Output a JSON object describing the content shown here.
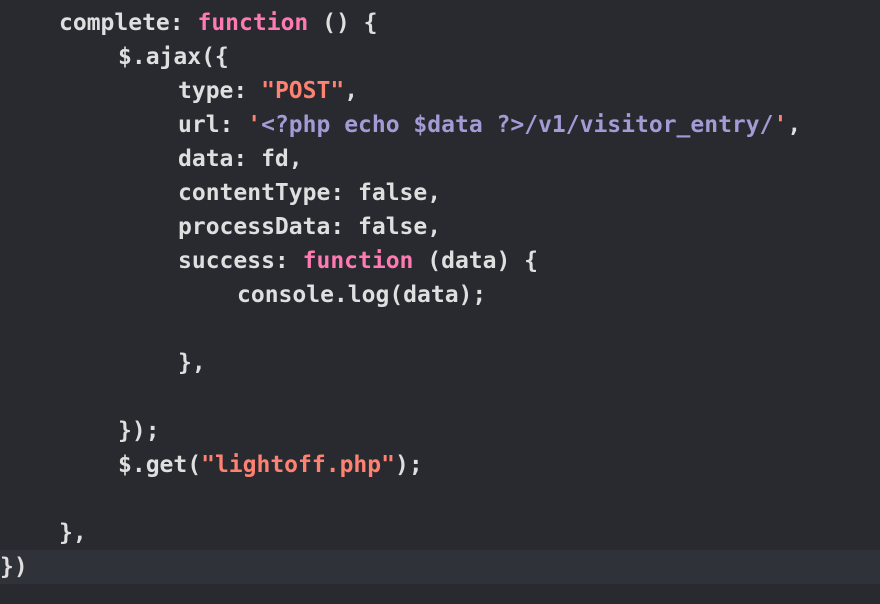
{
  "editor": {
    "colors": {
      "background": "#292a30",
      "text": "#dfdfe0",
      "keyword": "#ff7ab2",
      "string": "#ff8170",
      "embedded_php": "#a29bd6",
      "current_line": "#2f3239"
    },
    "code": {
      "l1": {
        "a": "complete: ",
        "kw": "function",
        "b": " () {"
      },
      "l2": {
        "a": "$.ajax({"
      },
      "l3": {
        "a": "type: ",
        "str": "\"POST\"",
        "b": ","
      },
      "l4": {
        "a": "url: ",
        "q1": "'",
        "php": "<?php echo $data ?>",
        "s": "/v1/visitor_entry/",
        "q2": "'",
        "b": ","
      },
      "l5": {
        "a": "data: fd,"
      },
      "l6": {
        "a": "contentType: false,"
      },
      "l7": {
        "a": "processData: false,"
      },
      "l8": {
        "a": "success: ",
        "kw": "function",
        "b": " (data) {"
      },
      "l9": {
        "a": "console.log(data);"
      },
      "l11": {
        "a": "},"
      },
      "l13": {
        "a": "});"
      },
      "l14": {
        "a": "$.get(",
        "str": "\"lightoff.php\"",
        "b": ");"
      },
      "l16": {
        "a": "},"
      },
      "l17": {
        "a": "})"
      }
    }
  }
}
